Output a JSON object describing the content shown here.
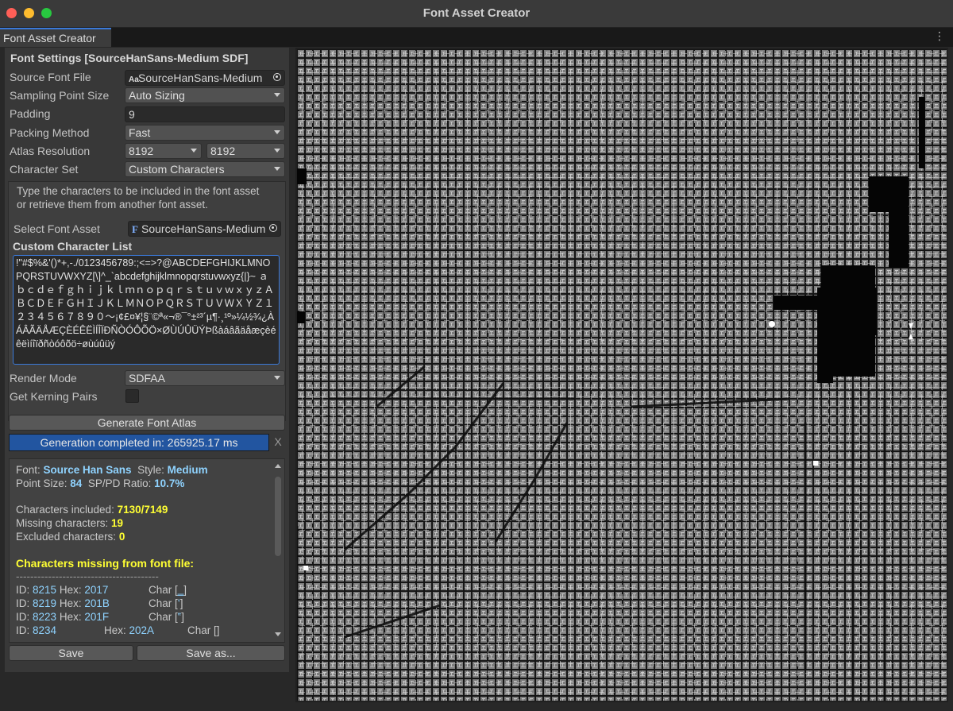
{
  "window": {
    "title": "Font Asset Creator",
    "tab": "Font Asset Creator",
    "menu_icon": "kebab-menu-icon"
  },
  "settings": {
    "header": "Font Settings [SourceHanSans-Medium SDF]",
    "source_font_label": "Source Font File",
    "source_font_value": "SourceHanSans-Medium",
    "sampling_label": "Sampling Point Size",
    "sampling_value": "Auto Sizing",
    "padding_label": "Padding",
    "padding_value": "9",
    "packing_label": "Packing Method",
    "packing_value": "Fast",
    "atlas_label": "Atlas Resolution",
    "atlas_w": "8192",
    "atlas_h": "8192",
    "charset_label": "Character Set",
    "charset_value": "Custom Characters",
    "help_line1": "Type the characters to be included in the font asset",
    "help_line2": "or retrieve them from another font asset.",
    "select_asset_label": "Select Font Asset",
    "select_asset_value": "SourceHanSans-Medium",
    "custom_list_label": "Custom Character List",
    "custom_list_value": "!\"#$%&'()*+,-./0123456789:;<=>?@ABCDEFGHIJKLMNOPQRSTUVWXYZ[\\]^_`abcdefghijklmnopqrstuvwxyz{|}~ ａｂｃｄｅｆｇｈｉｊｋｌｍｎｏｐｑｒｓｔｕｖｗｘｙｚＡＢＣＤＥＦＧＨＩＪＫＬＭＮＯＰＱＲＳＴＵＶＷＸＹＺ１２３４５６７８９０～¡¢£¤¥¦§¨©ª«¬®¯°±²³´µ¶·¸¹º»¼½¾¿ÀÁÂÃÄÅÆÇÈÉÊËÌÍÎÏÐÑÒÓÔÕÖ×ØÙÚÛÜÝÞßàáâãäåæçèéêëìíîïðñòóôõö÷øùúûüý",
    "render_mode_label": "Render Mode",
    "render_mode_value": "SDFAA",
    "kerning_label": "Get Kerning Pairs"
  },
  "actions": {
    "generate": "Generate Font Atlas",
    "progress_text": "Generation completed in: 265925.17 ms",
    "progress_fraction": 1.0,
    "close": "X",
    "save": "Save",
    "save_as": "Save as..."
  },
  "info": {
    "font_label": "Font: ",
    "font_value": "Source Han Sans",
    "style_label": "Style: ",
    "style_value": "Medium",
    "point_label": "Point Size: ",
    "point_value": "84",
    "ratio_label": "SP/PD Ratio: ",
    "ratio_value": "10.7%",
    "included_label": "Characters included: ",
    "included_value": "7130/7149",
    "missing_label": "Missing characters: ",
    "missing_value": "19",
    "excluded_label": "Excluded characters: ",
    "excluded_value": "0",
    "missing_header": "Characters missing from font file:",
    "separator": "----------------------------------------",
    "rows": [
      {
        "id_label": "ID: ",
        "id": "8215",
        "hex_label": "Hex: ",
        "hex": "2017",
        "char_label": "Char [",
        "char": "‗",
        "close": "]"
      },
      {
        "id_label": "ID: ",
        "id": "8219",
        "hex_label": "Hex: ",
        "hex": "201B",
        "char_label": "Char [",
        "char": "‛",
        "close": "]"
      },
      {
        "id_label": "ID: ",
        "id": "8223",
        "hex_label": "Hex: ",
        "hex": "201F",
        "char_label": "Char [",
        "char": "‟",
        "close": "]"
      },
      {
        "id_label": "ID: ",
        "id": "8234",
        "hex_label": "Hex: ",
        "hex": "202A",
        "char_label": "Char [",
        "char": "",
        "close": "]"
      }
    ]
  },
  "colors": {
    "accent": "#3a79d8",
    "progress": "#2255a0",
    "cyan_value": "#8fd3ff",
    "yellow_value": "#ffff33"
  }
}
